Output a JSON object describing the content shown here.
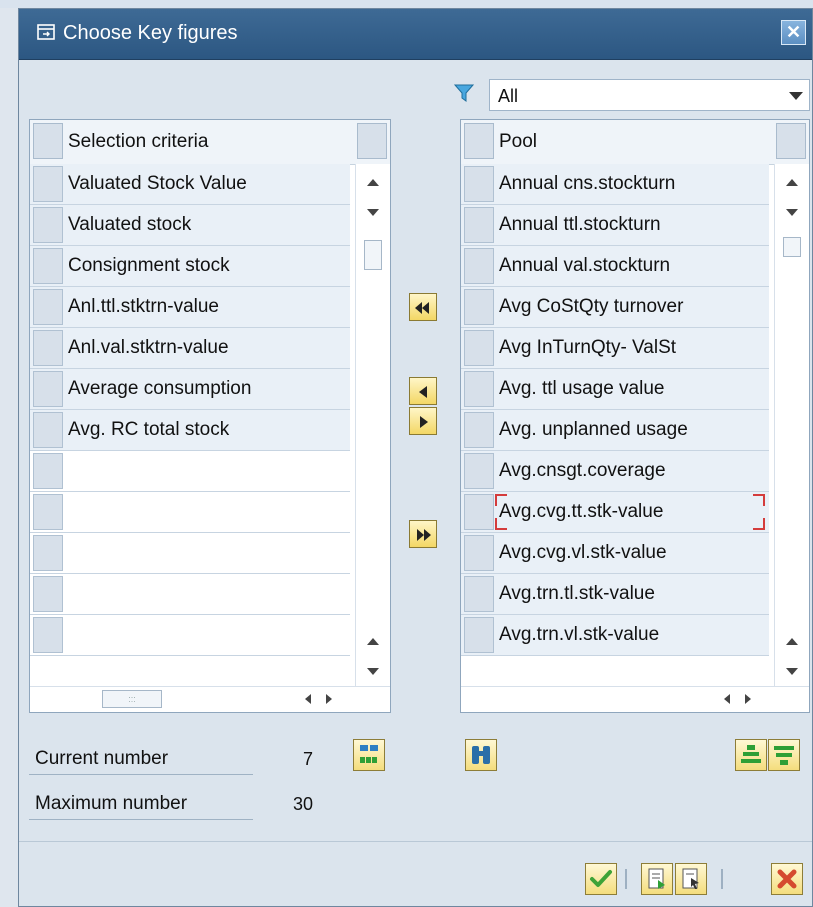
{
  "dialog": {
    "title": "Choose Key figures",
    "close_symbol": "✕"
  },
  "filter": {
    "icon": "filter-icon",
    "value": "All"
  },
  "left_table": {
    "header": "Selection criteria",
    "rows": [
      "Valuated Stock Value",
      "Valuated stock",
      "Consignment stock",
      "Anl.ttl.stktrn-value",
      "Anl.val.stktrn-value",
      "Average consumption",
      "Avg. RC total stock",
      "",
      "",
      "",
      "",
      ""
    ]
  },
  "right_table": {
    "header": "Pool",
    "rows": [
      "Annual cns.stockturn",
      "Annual ttl.stockturn",
      "Annual val.stockturn",
      "Avg CoStQty turnover",
      "Avg InTurnQty- ValSt",
      "Avg. ttl usage value",
      "Avg. unplanned usage",
      "Avg.cnsgt.coverage",
      "Avg.cvg.tt.stk-value",
      "Avg.cvg.vl.stk-value",
      "Avg.trn.tl.stk-value",
      "Avg.trn.vl.stk-value"
    ]
  },
  "counts": {
    "current_label": "Current number",
    "current_value": "7",
    "maximum_label": "Maximum number",
    "maximum_value": "30"
  },
  "colors": {
    "titlebar": "#2f5c88",
    "button_yellow": "#f3d765",
    "ok_green": "#3fa338",
    "cancel_red": "#d54a2f"
  }
}
